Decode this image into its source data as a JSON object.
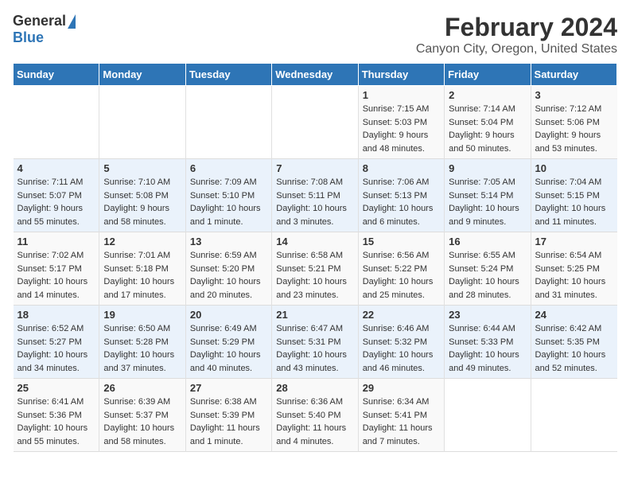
{
  "logo": {
    "general": "General",
    "blue": "Blue"
  },
  "header": {
    "title": "February 2024",
    "subtitle": "Canyon City, Oregon, United States"
  },
  "days_of_week": [
    "Sunday",
    "Monday",
    "Tuesday",
    "Wednesday",
    "Thursday",
    "Friday",
    "Saturday"
  ],
  "weeks": [
    [
      {
        "day": "",
        "info": ""
      },
      {
        "day": "",
        "info": ""
      },
      {
        "day": "",
        "info": ""
      },
      {
        "day": "",
        "info": ""
      },
      {
        "day": "1",
        "info": "Sunrise: 7:15 AM\nSunset: 5:03 PM\nDaylight: 9 hours\nand 48 minutes."
      },
      {
        "day": "2",
        "info": "Sunrise: 7:14 AM\nSunset: 5:04 PM\nDaylight: 9 hours\nand 50 minutes."
      },
      {
        "day": "3",
        "info": "Sunrise: 7:12 AM\nSunset: 5:06 PM\nDaylight: 9 hours\nand 53 minutes."
      }
    ],
    [
      {
        "day": "4",
        "info": "Sunrise: 7:11 AM\nSunset: 5:07 PM\nDaylight: 9 hours\nand 55 minutes."
      },
      {
        "day": "5",
        "info": "Sunrise: 7:10 AM\nSunset: 5:08 PM\nDaylight: 9 hours\nand 58 minutes."
      },
      {
        "day": "6",
        "info": "Sunrise: 7:09 AM\nSunset: 5:10 PM\nDaylight: 10 hours\nand 1 minute."
      },
      {
        "day": "7",
        "info": "Sunrise: 7:08 AM\nSunset: 5:11 PM\nDaylight: 10 hours\nand 3 minutes."
      },
      {
        "day": "8",
        "info": "Sunrise: 7:06 AM\nSunset: 5:13 PM\nDaylight: 10 hours\nand 6 minutes."
      },
      {
        "day": "9",
        "info": "Sunrise: 7:05 AM\nSunset: 5:14 PM\nDaylight: 10 hours\nand 9 minutes."
      },
      {
        "day": "10",
        "info": "Sunrise: 7:04 AM\nSunset: 5:15 PM\nDaylight: 10 hours\nand 11 minutes."
      }
    ],
    [
      {
        "day": "11",
        "info": "Sunrise: 7:02 AM\nSunset: 5:17 PM\nDaylight: 10 hours\nand 14 minutes."
      },
      {
        "day": "12",
        "info": "Sunrise: 7:01 AM\nSunset: 5:18 PM\nDaylight: 10 hours\nand 17 minutes."
      },
      {
        "day": "13",
        "info": "Sunrise: 6:59 AM\nSunset: 5:20 PM\nDaylight: 10 hours\nand 20 minutes."
      },
      {
        "day": "14",
        "info": "Sunrise: 6:58 AM\nSunset: 5:21 PM\nDaylight: 10 hours\nand 23 minutes."
      },
      {
        "day": "15",
        "info": "Sunrise: 6:56 AM\nSunset: 5:22 PM\nDaylight: 10 hours\nand 25 minutes."
      },
      {
        "day": "16",
        "info": "Sunrise: 6:55 AM\nSunset: 5:24 PM\nDaylight: 10 hours\nand 28 minutes."
      },
      {
        "day": "17",
        "info": "Sunrise: 6:54 AM\nSunset: 5:25 PM\nDaylight: 10 hours\nand 31 minutes."
      }
    ],
    [
      {
        "day": "18",
        "info": "Sunrise: 6:52 AM\nSunset: 5:27 PM\nDaylight: 10 hours\nand 34 minutes."
      },
      {
        "day": "19",
        "info": "Sunrise: 6:50 AM\nSunset: 5:28 PM\nDaylight: 10 hours\nand 37 minutes."
      },
      {
        "day": "20",
        "info": "Sunrise: 6:49 AM\nSunset: 5:29 PM\nDaylight: 10 hours\nand 40 minutes."
      },
      {
        "day": "21",
        "info": "Sunrise: 6:47 AM\nSunset: 5:31 PM\nDaylight: 10 hours\nand 43 minutes."
      },
      {
        "day": "22",
        "info": "Sunrise: 6:46 AM\nSunset: 5:32 PM\nDaylight: 10 hours\nand 46 minutes."
      },
      {
        "day": "23",
        "info": "Sunrise: 6:44 AM\nSunset: 5:33 PM\nDaylight: 10 hours\nand 49 minutes."
      },
      {
        "day": "24",
        "info": "Sunrise: 6:42 AM\nSunset: 5:35 PM\nDaylight: 10 hours\nand 52 minutes."
      }
    ],
    [
      {
        "day": "25",
        "info": "Sunrise: 6:41 AM\nSunset: 5:36 PM\nDaylight: 10 hours\nand 55 minutes."
      },
      {
        "day": "26",
        "info": "Sunrise: 6:39 AM\nSunset: 5:37 PM\nDaylight: 10 hours\nand 58 minutes."
      },
      {
        "day": "27",
        "info": "Sunrise: 6:38 AM\nSunset: 5:39 PM\nDaylight: 11 hours\nand 1 minute."
      },
      {
        "day": "28",
        "info": "Sunrise: 6:36 AM\nSunset: 5:40 PM\nDaylight: 11 hours\nand 4 minutes."
      },
      {
        "day": "29",
        "info": "Sunrise: 6:34 AM\nSunset: 5:41 PM\nDaylight: 11 hours\nand 7 minutes."
      },
      {
        "day": "",
        "info": ""
      },
      {
        "day": "",
        "info": ""
      }
    ]
  ]
}
